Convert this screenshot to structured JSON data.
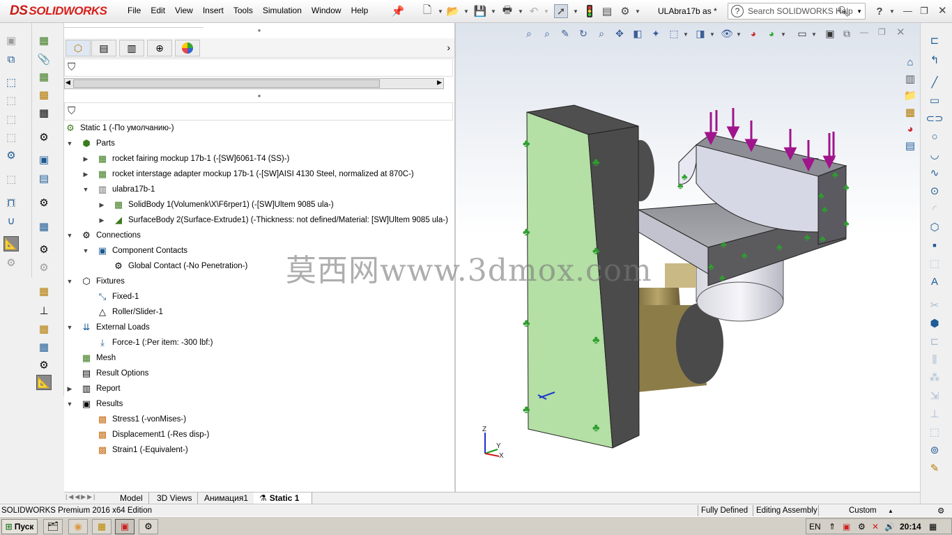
{
  "app": {
    "brand": "SOLIDWORKS",
    "brand_prefix": "DS",
    "menus": [
      "File",
      "Edit",
      "View",
      "Insert",
      "Tools",
      "Simulation",
      "Window",
      "Help"
    ],
    "document_title": "ULAbra17b as *",
    "search_placeholder": "Search SOLIDWORKS Help",
    "help_label": "?"
  },
  "feature_tree": {
    "root": "Static 1 (-По умолчанию-)",
    "parts": "Parts",
    "part1": "rocket fairing mockup 17b-1 (-[SW]6061-T4 (SS)-)",
    "part2": "rocket interstage adapter mockup 17b-1 (-[SW]AISI 4130 Steel, normalized at 870C-)",
    "part3": "ulabra17b-1",
    "body1": "SolidBody 1(Volumenk\\X\\F6rper1) (-[SW]Ultem 9085 ula-)",
    "body2": "SurfaceBody 2(Surface-Extrude1) (-Thickness: not defined/Material: [SW]Ultem 9085 ula-)",
    "connections": "Connections",
    "component_contacts": "Component Contacts",
    "global_contact": "Global Contact (-No Penetration-)",
    "fixtures": "Fixtures",
    "fixed": "Fixed-1",
    "roller": "Roller/Slider-1",
    "external_loads": "External Loads",
    "force": "Force-1 (:Per item: -300 lbf:)",
    "mesh": "Mesh",
    "result_options": "Result Options",
    "report": "Report",
    "results": "Results",
    "stress": "Stress1 (-vonMises-)",
    "displacement": "Displacement1 (-Res disp-)",
    "strain": "Strain1 (-Equivalent-)"
  },
  "bottom_tabs": [
    "Model",
    "3D Views",
    "Анимация1",
    "Static 1"
  ],
  "status": {
    "edition": "SOLIDWORKS Premium 2016 x64 Edition",
    "state": "Fully Defined",
    "mode": "Editing Assembly",
    "units": "Custom"
  },
  "taskbar": {
    "start": "Пуск",
    "lang": "EN",
    "time": "20:14"
  },
  "watermark": "莫西网www.3dmox.com",
  "triad": {
    "z": "Z",
    "y": "Y",
    "x": "X"
  },
  "colors": {
    "brand_red": "#d6201a",
    "plate_face": "#b4dfa5",
    "load_arrow": "#a0148c",
    "fixture_green": "#2e9e2e"
  }
}
